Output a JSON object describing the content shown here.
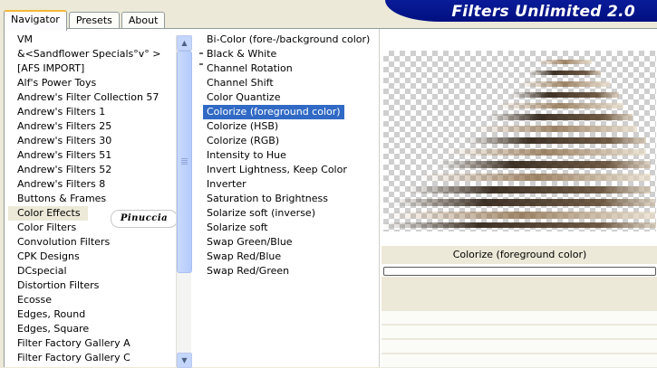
{
  "tabs": [
    {
      "label": "Navigator"
    },
    {
      "label": "Presets"
    },
    {
      "label": "About"
    }
  ],
  "banner": {
    "title": "Filters Unlimited 2.0"
  },
  "categories": [
    {
      "label": "VM"
    },
    {
      "label": "&<Sandflower Specials°v° >"
    },
    {
      "label": "[AFS IMPORT]"
    },
    {
      "label": "Alf's Power Toys"
    },
    {
      "label": "Andrew's Filter Collection 57"
    },
    {
      "label": "Andrew's Filters 1"
    },
    {
      "label": "Andrew's Filters 25"
    },
    {
      "label": "Andrew's Filters 30"
    },
    {
      "label": "Andrew's Filters 51"
    },
    {
      "label": "Andrew's Filters 52"
    },
    {
      "label": "Andrew's Filters 8"
    },
    {
      "label": "Buttons & Frames"
    },
    {
      "label": "Color Effects"
    },
    {
      "label": "Color Filters"
    },
    {
      "label": "Convolution Filters"
    },
    {
      "label": "CPK Designs"
    },
    {
      "label": "DCspecial"
    },
    {
      "label": "Distortion Filters"
    },
    {
      "label": "Ecosse"
    },
    {
      "label": "Edges, Round"
    },
    {
      "label": "Edges, Square"
    },
    {
      "label": "Filter Factory Gallery A"
    },
    {
      "label": "Filter Factory Gallery C"
    }
  ],
  "selected_category_index": 12,
  "filters": [
    {
      "label": "Bi-Color (fore-/background color)"
    },
    {
      "label": "Black & White"
    },
    {
      "label": "Channel Rotation"
    },
    {
      "label": "Channel Shift"
    },
    {
      "label": "Color Quantize"
    },
    {
      "label": "Colorize (foreground color)"
    },
    {
      "label": "Colorize (HSB)"
    },
    {
      "label": "Colorize (RGB)"
    },
    {
      "label": "Intensity to Hue"
    },
    {
      "label": "Invert Lightness, Keep Color"
    },
    {
      "label": "Inverter"
    },
    {
      "label": "Saturation to Brightness"
    },
    {
      "label": "Solarize soft (inverse)"
    },
    {
      "label": "Solarize soft"
    },
    {
      "label": "Swap Green/Blue"
    },
    {
      "label": "Swap Red/Blue"
    },
    {
      "label": "Swap Red/Green"
    }
  ],
  "selected_filter_index": 5,
  "watermark": {
    "text": "Pinuccia"
  },
  "preview": {
    "status_label": "Colorize (foreground color)",
    "progress": 0
  },
  "colors": {
    "banner": "#001080",
    "selection": "#316ac5",
    "tab_highlight": "#f5b73a",
    "dialog_bg": "#ece9d8"
  }
}
